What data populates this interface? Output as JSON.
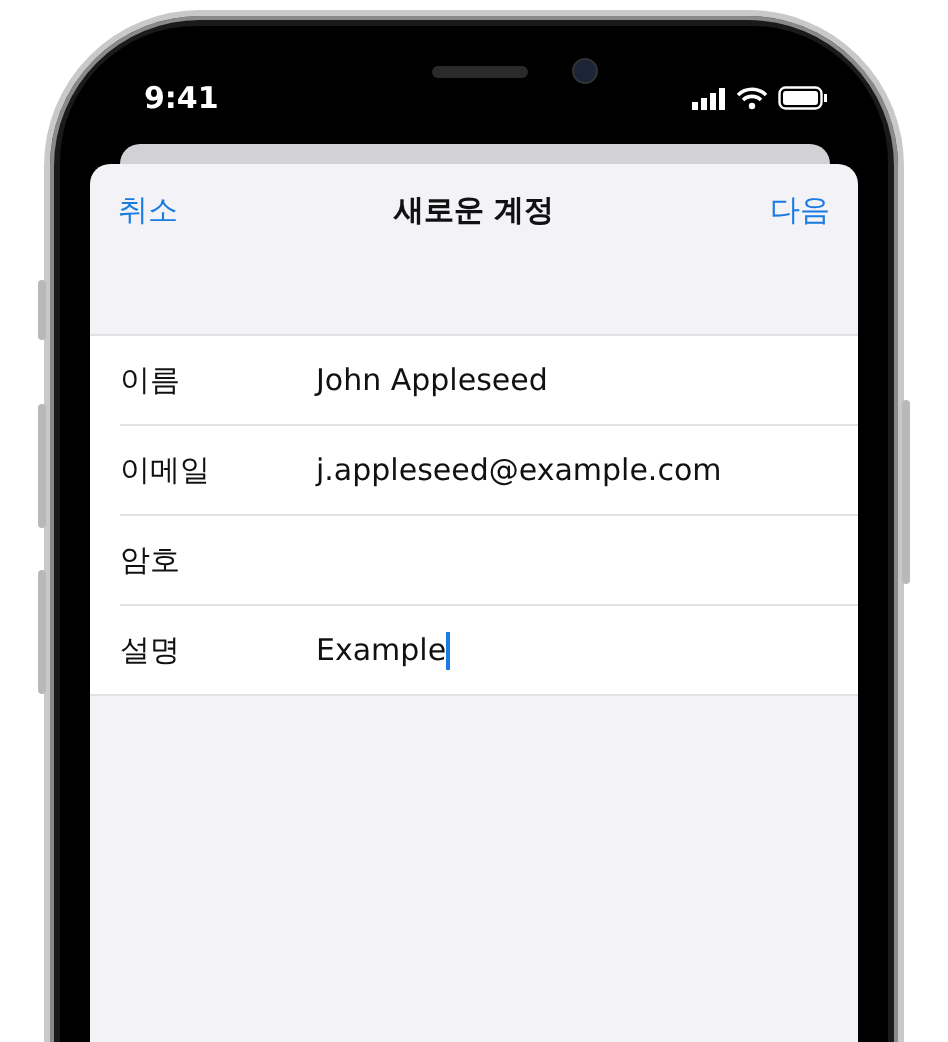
{
  "status_bar": {
    "time": "9:41"
  },
  "sheet": {
    "cancel": "취소",
    "title": "새로운 계정",
    "next": "다음"
  },
  "fields": [
    {
      "label": "이름",
      "value": "John Appleseed",
      "focused": false
    },
    {
      "label": "이메일",
      "value": "j.appleseed@example.com",
      "focused": false
    },
    {
      "label": "암호",
      "focused": false
    },
    {
      "label": "설명",
      "value": "Example",
      "focused": true
    }
  ]
}
